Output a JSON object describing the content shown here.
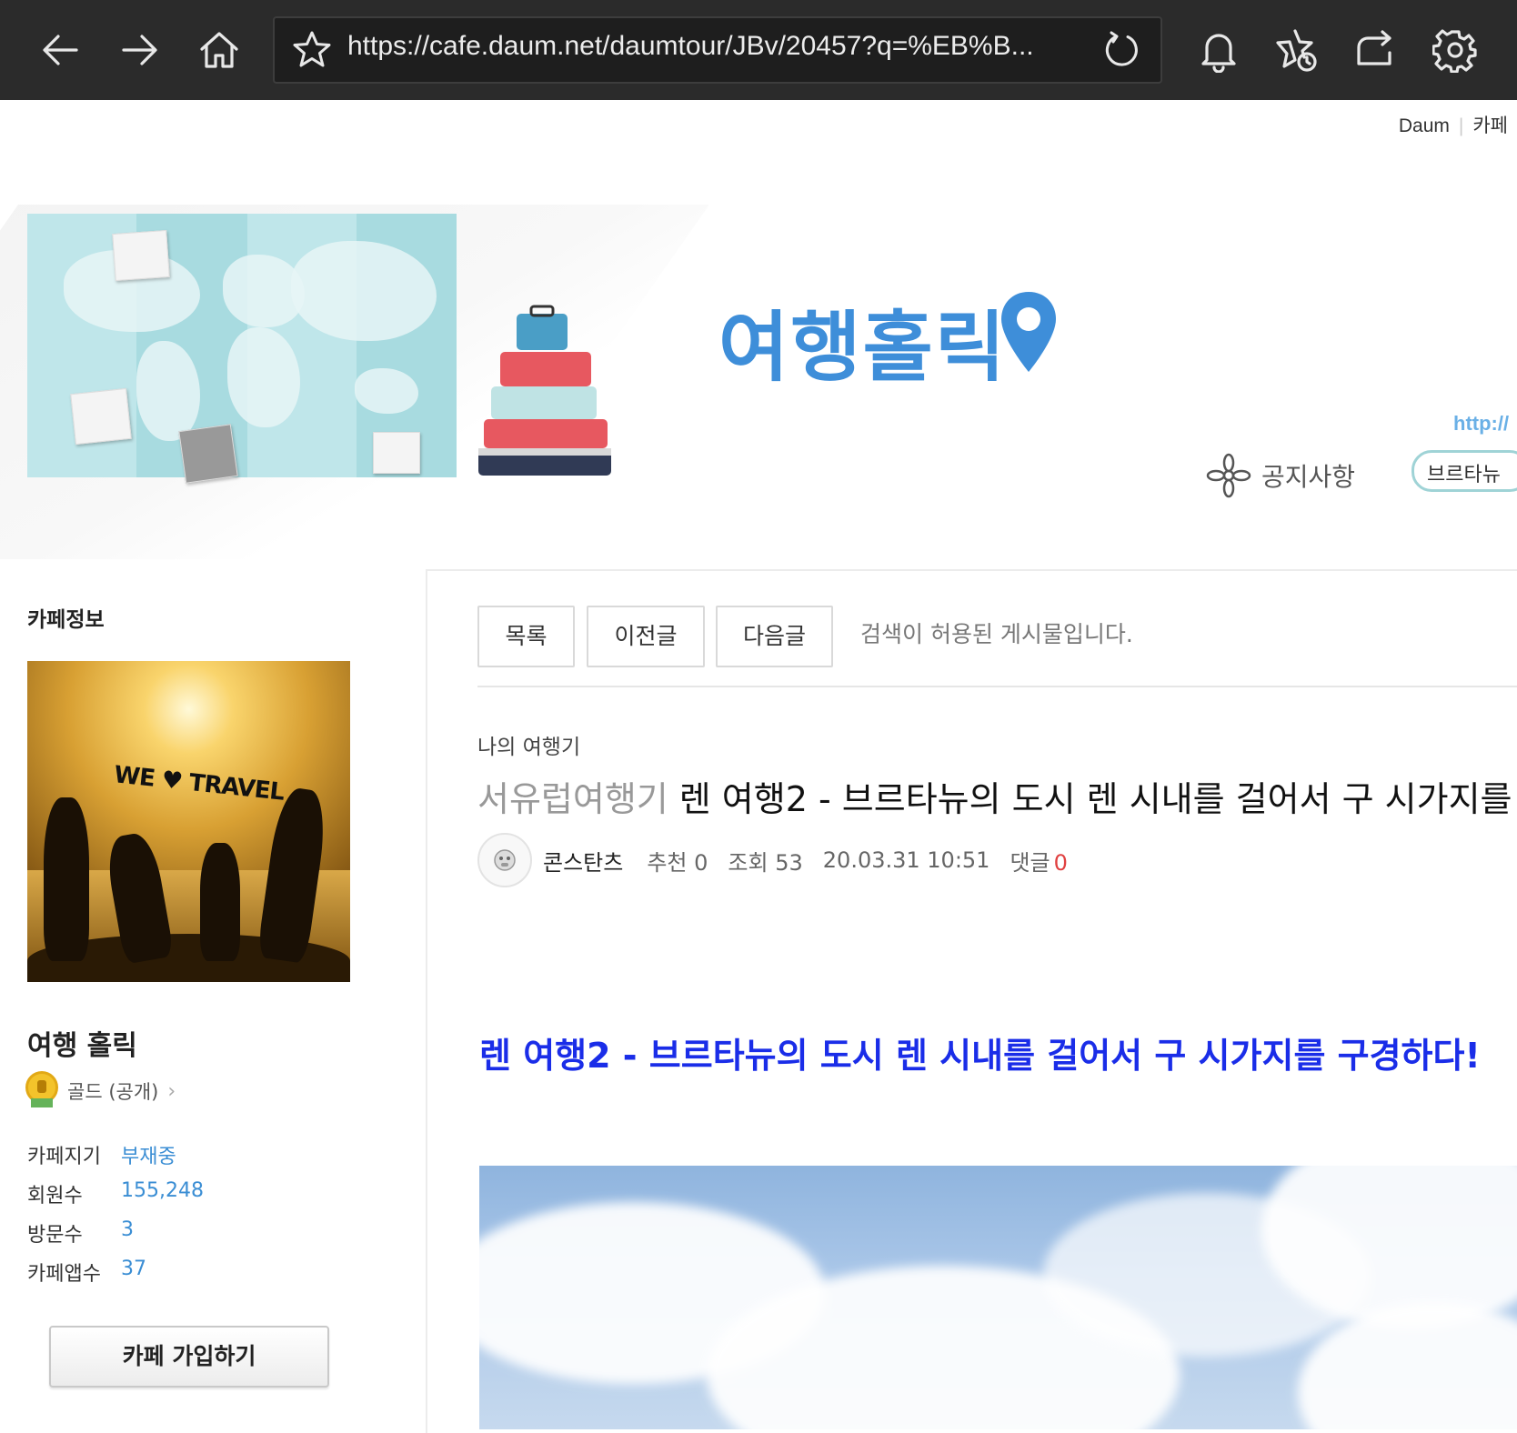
{
  "browser": {
    "url": "https://cafe.daum.net/daumtour/JBv/20457?q=%EB%B..."
  },
  "top_links": [
    "Daum",
    "카페"
  ],
  "banner": {
    "logo_text": "여행홀릭",
    "url_fragment": "http://",
    "notice_label": "공지사항",
    "tab_label": "브르타뉴"
  },
  "sidebar": {
    "title": "카페정보",
    "photo_text": "WE ♥ TRAVEL",
    "cafe_name": "여행 홀릭",
    "grade": "골드 (공개)",
    "info": [
      {
        "key": "카페지기",
        "value": "부재중"
      },
      {
        "key": "회원수",
        "value": "155,248"
      },
      {
        "key": "방문수",
        "value": "3"
      },
      {
        "key": "카페앱수",
        "value": "37"
      }
    ],
    "join_button": "카페 가입하기"
  },
  "post": {
    "buttons": {
      "list": "목록",
      "prev": "이전글",
      "next": "다음글"
    },
    "search_note": "검색이 허용된 게시물입니다.",
    "category": "나의 여행기",
    "title_head": "서유럽여행기",
    "title": "렌 여행2 - 브르타뉴의 도시 렌 시내를 걸어서 구 시가지를",
    "author": "콘스탄츠",
    "recommend_label": "추천",
    "recommend": "0",
    "views_label": "조회",
    "views": "53",
    "date": "20.03.31 10:51",
    "comments_label": "댓글",
    "comments": "0",
    "body_heading": "렌 여행2 - 브르타뉴의 도시 렌 시내를 걸어서 구 시가지를 구경하다!"
  }
}
